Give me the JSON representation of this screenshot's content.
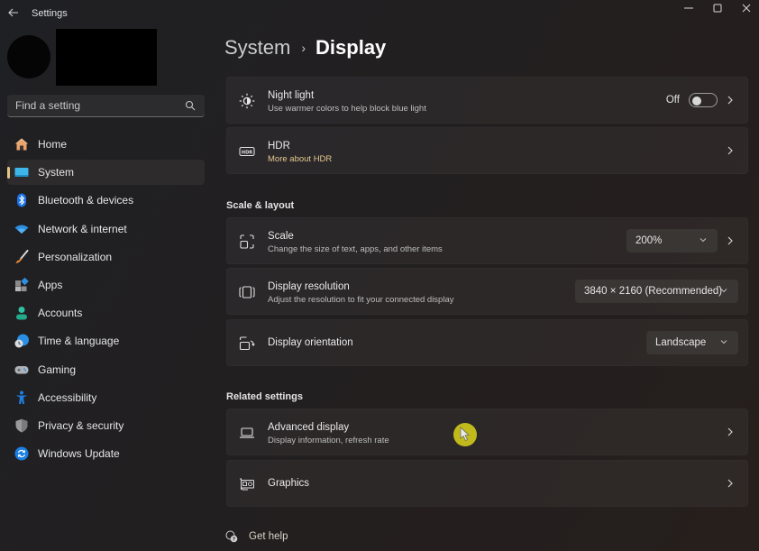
{
  "window": {
    "title": "Settings",
    "controls": {
      "minimize": "minimize",
      "maximize": "maximize",
      "close": "close"
    }
  },
  "sidebar": {
    "search": {
      "placeholder": "Find a setting",
      "value": ""
    },
    "items": [
      {
        "label": "Home",
        "icon": "home-icon",
        "active": false
      },
      {
        "label": "System",
        "icon": "system-icon",
        "active": true
      },
      {
        "label": "Bluetooth & devices",
        "icon": "bluetooth-icon",
        "active": false
      },
      {
        "label": "Network & internet",
        "icon": "wifi-icon",
        "active": false
      },
      {
        "label": "Personalization",
        "icon": "brush-icon",
        "active": false
      },
      {
        "label": "Apps",
        "icon": "apps-icon",
        "active": false
      },
      {
        "label": "Accounts",
        "icon": "accounts-icon",
        "active": false
      },
      {
        "label": "Time & language",
        "icon": "time-language-icon",
        "active": false
      },
      {
        "label": "Gaming",
        "icon": "gamepad-icon",
        "active": false
      },
      {
        "label": "Accessibility",
        "icon": "accessibility-icon",
        "active": false
      },
      {
        "label": "Privacy & security",
        "icon": "shield-icon",
        "active": false
      },
      {
        "label": "Windows Update",
        "icon": "update-icon",
        "active": false
      }
    ]
  },
  "breadcrumb": {
    "parent": "System",
    "separator": "›",
    "current": "Display"
  },
  "cards": {
    "night_light": {
      "title": "Night light",
      "subtitle": "Use warmer colors to help block blue light",
      "toggle_state": "Off",
      "toggle_on": false
    },
    "hdr": {
      "title": "HDR",
      "subtitle": "More about HDR"
    }
  },
  "scale_layout": {
    "heading": "Scale & layout",
    "scale": {
      "title": "Scale",
      "subtitle": "Change the size of text, apps, and other items",
      "value": "200%"
    },
    "resolution": {
      "title": "Display resolution",
      "subtitle": "Adjust the resolution to fit your connected display",
      "value": "3840 × 2160 (Recommended)"
    },
    "orientation": {
      "title": "Display orientation",
      "value": "Landscape"
    }
  },
  "related": {
    "heading": "Related settings",
    "advanced": {
      "title": "Advanced display",
      "subtitle": "Display information, refresh rate"
    },
    "graphics": {
      "title": "Graphics"
    }
  },
  "help": {
    "label": "Get help"
  },
  "colors": {
    "accent": "#e4c486",
    "link": "#e3c88f",
    "cursor_highlight": "#c9c21c"
  }
}
